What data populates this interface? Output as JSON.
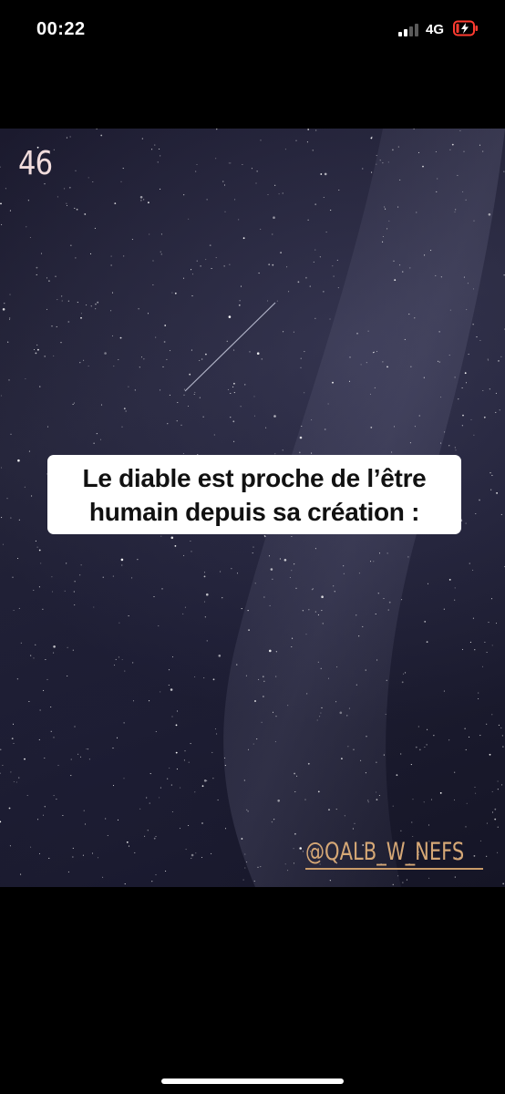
{
  "status_bar": {
    "time": "00:22",
    "network": "4G",
    "icons": [
      "signal-icon",
      "battery-charging-icon"
    ]
  },
  "story": {
    "post_number": "46",
    "caption": [
      "Le diable est proche de l’être",
      "humain depuis sa création :"
    ],
    "handle": "@QALB_W_NEFS"
  },
  "colors": {
    "background": "#000000",
    "sky": "#1e1e33",
    "post_number": "#f1dcdc",
    "handle": "#d6a876",
    "caption_box": "#ffffff",
    "battery_low": "#ff3b30"
  }
}
